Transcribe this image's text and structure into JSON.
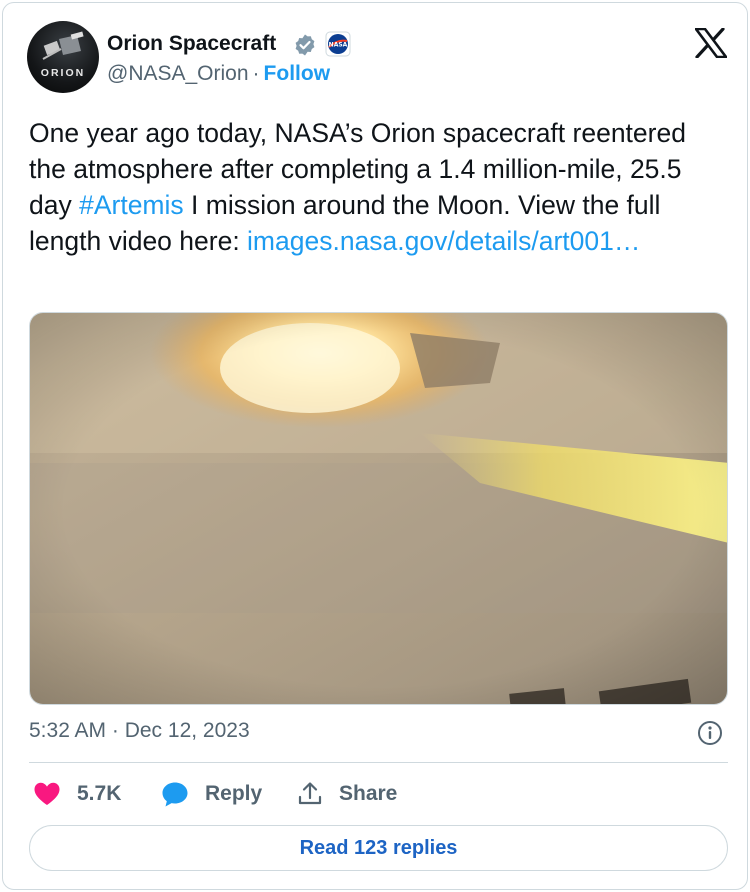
{
  "account": {
    "display_name": "Orion Spacecraft",
    "handle": "@NASA_Orion",
    "separator": "·",
    "follow_label": "Follow",
    "avatar_text": "ORION",
    "affiliate_badge_text": "NASA"
  },
  "tweet": {
    "text_part1": "One year ago today, NASA’s Orion spacecraft reentered the atmosphere after completing a 1.4 million-mile, 25.5 day ",
    "hashtag": "#Artemis",
    "text_part2": " I mission around the Moon. View the full length video here: ",
    "link": "images.nasa.gov/details/art001…",
    "timestamp": "5:32 AM · Dec 12, 2023"
  },
  "actions": {
    "like_count": "5.7K",
    "reply_label": "Reply",
    "share_label": "Share",
    "read_replies_label": "Read 123 replies"
  },
  "colors": {
    "accent_blue": "#1d9bf0",
    "like_pink": "#f91880",
    "verified_gray": "#829aab",
    "secondary_text": "#536471"
  }
}
